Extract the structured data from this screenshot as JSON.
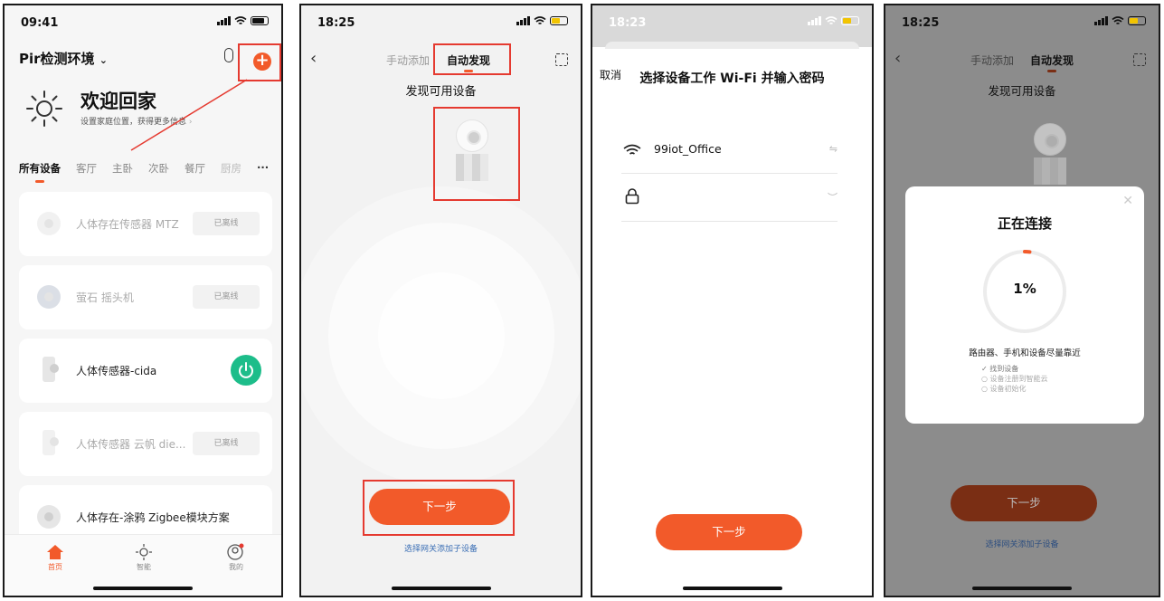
{
  "colors": {
    "accent": "#f25a2a",
    "annotation_red": "#e53a30",
    "online_green": "#1dbd8a",
    "link_blue": "#3b6fb5"
  },
  "screen1": {
    "time": "09:41",
    "home_name": "Pir检测环境",
    "add_icon": "plus-icon",
    "welcome": "欢迎回家",
    "subtitle": "设置家庭位置，获得更多信息",
    "tabs": [
      "所有设备",
      "客厅",
      "主卧",
      "次卧",
      "餐厅",
      "厨房"
    ],
    "more_icon": "···",
    "devices": [
      {
        "name": "人体存在传感器 MTZ",
        "status": "已离线"
      },
      {
        "name": "萤石 摇头机",
        "status": "已离线"
      },
      {
        "name": "人体传感器-cida",
        "status": "online"
      },
      {
        "name": "人体传感器 云帆 die...",
        "status": "已离线"
      },
      {
        "name": "人体存在-涂鸦 Zigbee模块方案",
        "status": ""
      }
    ],
    "tabbar": [
      "首页",
      "智能",
      "我的"
    ]
  },
  "screen2": {
    "time": "18:25",
    "tab_manual": "手动添加",
    "tab_auto": "自动发现",
    "title": "发现可用设备",
    "next": "下一步",
    "link": "选择网关添加子设备"
  },
  "screen3": {
    "time": "18:23",
    "cancel": "取消",
    "title": "选择设备工作 Wi-Fi 并输入密码",
    "ssid": "99iot_Office",
    "switch_icon": "⇋",
    "eye_icon": "︶",
    "next": "下一步"
  },
  "screen4": {
    "time": "18:25",
    "tab_manual": "手动添加",
    "tab_auto": "自动发现",
    "title": "发现可用设备",
    "modal_title": "正在连接",
    "progress": "1%",
    "progress_value": 0.01,
    "hint": "路由器、手机和设备尽量靠近",
    "steps": [
      "✓ 找到设备",
      "○ 设备注册到智能云",
      "○ 设备初始化"
    ],
    "next": "下一步",
    "link": "选择网关添加子设备"
  }
}
